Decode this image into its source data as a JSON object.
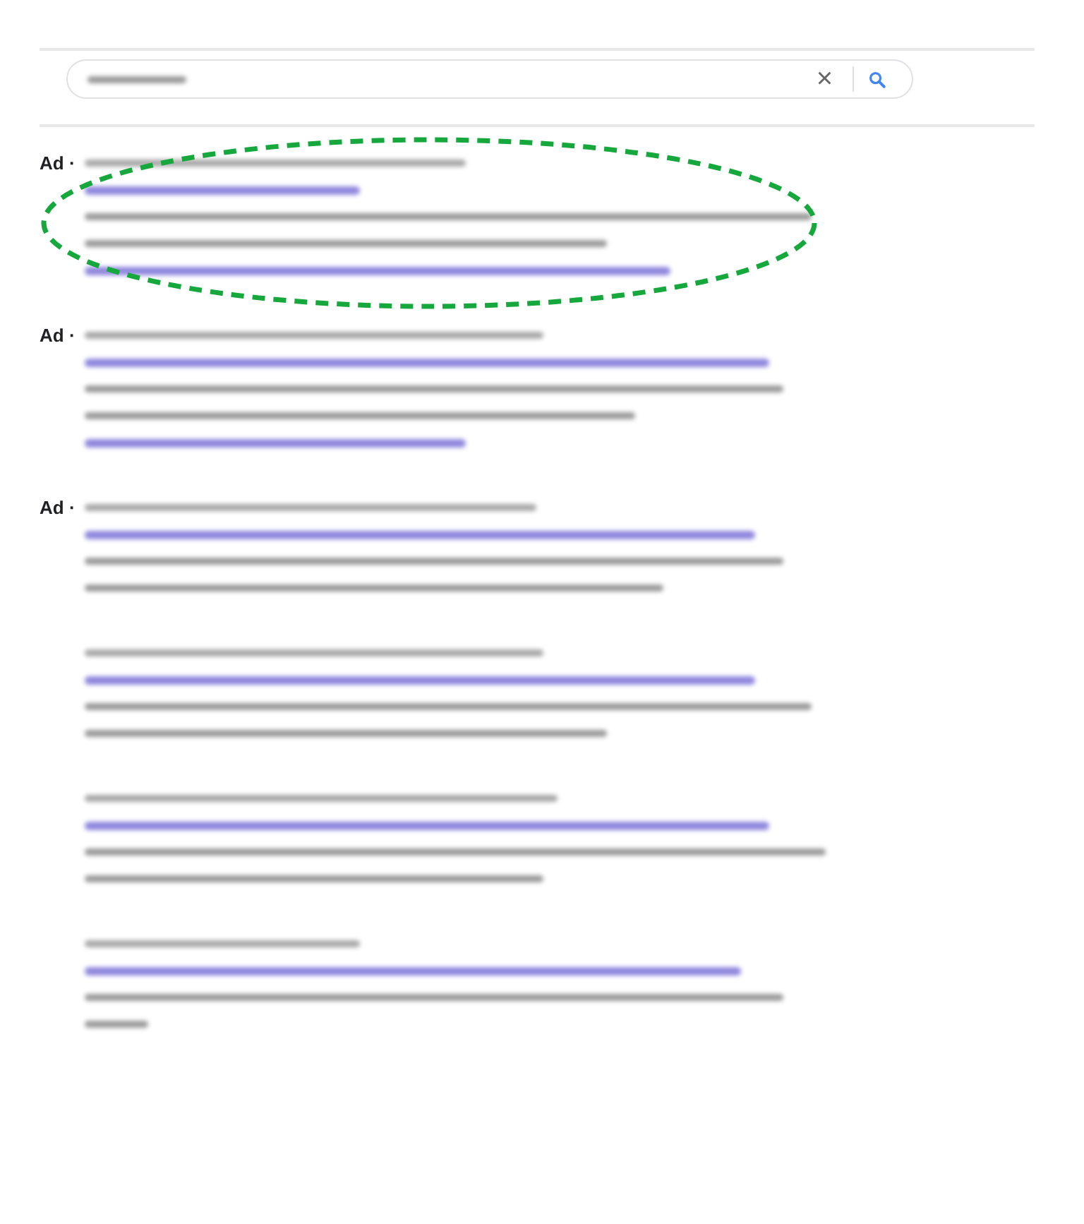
{
  "search": {
    "clear": "×"
  },
  "results": [
    {
      "ad_label": "Ad ·",
      "highlighted": true,
      "lines": [
        {
          "kind": "url"
        },
        {
          "kind": "title"
        },
        {
          "kind": "snippet"
        },
        {
          "kind": "snippet"
        },
        {
          "kind": "link"
        }
      ]
    },
    {
      "ad_label": "Ad ·",
      "lines": [
        {
          "kind": "url"
        },
        {
          "kind": "title"
        },
        {
          "kind": "snippet"
        },
        {
          "kind": "snippet"
        },
        {
          "kind": "link"
        }
      ]
    },
    {
      "ad_label": "Ad ·",
      "lines": [
        {
          "kind": "url"
        },
        {
          "kind": "title"
        },
        {
          "kind": "snippet"
        },
        {
          "kind": "snippet"
        }
      ]
    },
    {
      "lines": [
        {
          "kind": "url"
        },
        {
          "kind": "title"
        },
        {
          "kind": "snippet"
        },
        {
          "kind": "snippet"
        }
      ]
    },
    {
      "lines": [
        {
          "kind": "url"
        },
        {
          "kind": "title"
        },
        {
          "kind": "snippet"
        },
        {
          "kind": "snippet"
        }
      ]
    },
    {
      "lines": [
        {
          "kind": "url"
        },
        {
          "kind": "title"
        },
        {
          "kind": "snippet"
        },
        {
          "kind": "snippet"
        }
      ]
    }
  ]
}
